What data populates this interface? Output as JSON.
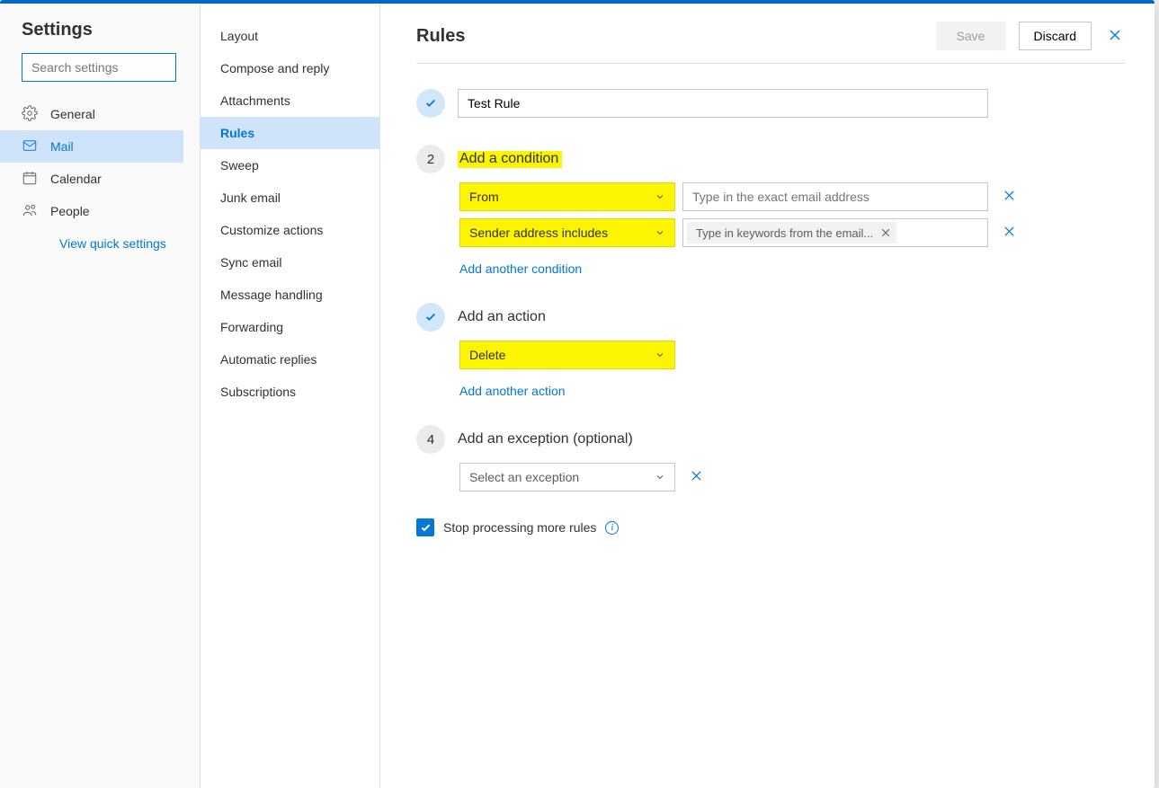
{
  "settings_title": "Settings",
  "search_placeholder": "Search settings",
  "quick_settings": "View quick settings",
  "categories": [
    {
      "id": "general",
      "label": "General"
    },
    {
      "id": "mail",
      "label": "Mail"
    },
    {
      "id": "calendar",
      "label": "Calendar"
    },
    {
      "id": "people",
      "label": "People"
    }
  ],
  "subnav": [
    "Layout",
    "Compose and reply",
    "Attachments",
    "Rules",
    "Sweep",
    "Junk email",
    "Customize actions",
    "Sync email",
    "Message handling",
    "Forwarding",
    "Automatic replies",
    "Subscriptions"
  ],
  "subnav_active": "Rules",
  "content": {
    "title": "Rules",
    "save": "Save",
    "discard": "Discard",
    "rule_name": "Test Rule",
    "step_condition_title": "Add a condition",
    "step_condition_num": "2",
    "conditions": [
      {
        "type": "From",
        "value_placeholder": "Type in the exact email address",
        "value": ""
      },
      {
        "type": "Sender address includes",
        "tag": "Type in keywords from the email..."
      }
    ],
    "add_condition": "Add another condition",
    "step_action_title": "Add an action",
    "action_dropdown": "Delete",
    "add_action": "Add another action",
    "step_exception_num": "4",
    "step_exception_title": "Add an exception (optional)",
    "exception_placeholder": "Select an exception",
    "stop_processing": "Stop processing more rules"
  }
}
